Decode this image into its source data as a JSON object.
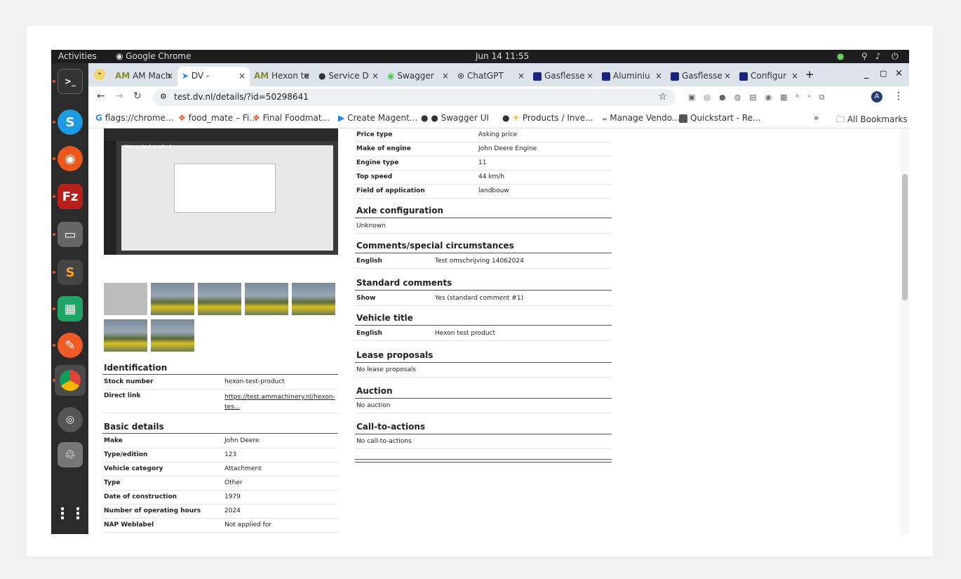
{
  "topbar": {
    "activities": "Activities",
    "app": "Google Chrome",
    "clock": "Jun 14  11:55"
  },
  "tabs": [
    {
      "label": "AM Mach",
      "icon": "AM"
    },
    {
      "label": "DV -",
      "icon": "dv-icon"
    },
    {
      "label": "Hexon te",
      "icon": "AM"
    },
    {
      "label": "Service D",
      "icon": "github-icon"
    },
    {
      "label": "Swagger",
      "icon": "swagger-icon"
    },
    {
      "label": "ChatGPT",
      "icon": "openai-icon"
    },
    {
      "label": "Gasflesse",
      "icon": "M"
    },
    {
      "label": "Aluminiu",
      "icon": "M"
    },
    {
      "label": "Gasflesse",
      "icon": "M"
    },
    {
      "label": "Configur",
      "icon": "M"
    }
  ],
  "new_tab": "+",
  "address": "test.dv.nl/details/?id=50298641",
  "bookmarks": [
    "flags://chrome...",
    "food_mate – Fi...",
    "Final Foodmat...",
    "Create Magent...",
    "Swagger UI",
    "Products / Inve...",
    "Manage Vendo...",
    "Quickstart - Re..."
  ],
  "bookmarks_more": "»",
  "all_bookmarks": "All Bookmarks",
  "identification": {
    "title": "Identification",
    "rows": [
      {
        "k": "Stock number",
        "v": "hexon-test-product"
      },
      {
        "k": "Direct link",
        "v": "https://test.ammachinery.nl/hexon-tes..."
      }
    ]
  },
  "basic": {
    "title": "Basic details",
    "rows": [
      {
        "k": "Make",
        "v": "John Deere"
      },
      {
        "k": "Type/edition",
        "v": "123"
      },
      {
        "k": "Vehicle category",
        "v": "Attachment"
      },
      {
        "k": "Type",
        "v": "Other"
      },
      {
        "k": "Date of construction",
        "v": "1979"
      },
      {
        "k": "Number of operating hours",
        "v": "2024"
      },
      {
        "k": "NAP Weblabel",
        "v": "Not applied for"
      }
    ]
  },
  "right_top_rows": [
    {
      "k": "Price type",
      "v": "Asking price"
    },
    {
      "k": "Make of engine",
      "v": "John Deere Engine"
    },
    {
      "k": "Engine type",
      "v": "11"
    },
    {
      "k": "Top speed",
      "v": "44 km/h"
    },
    {
      "k": "Field of application",
      "v": "landbouw"
    }
  ],
  "axle": {
    "title": "Axle configuration",
    "value": "Unknown"
  },
  "comments": {
    "title": "Comments/special circumstances",
    "k": "English",
    "v": "Test omschrijving 14062024"
  },
  "standard": {
    "title": "Standard comments",
    "k": "Show",
    "v": "Yes (standard comment #1)"
  },
  "vehicle_title": {
    "title": "Vehicle title",
    "k": "English",
    "v": "Hexon test product"
  },
  "lease": {
    "title": "Lease proposals",
    "value": "No lease proposals"
  },
  "auction": {
    "title": "Auction",
    "value": "No auction"
  },
  "cta": {
    "title": "Call-to-actions",
    "value": "No call-to-actions"
  },
  "preview_title": "Hexon test product"
}
